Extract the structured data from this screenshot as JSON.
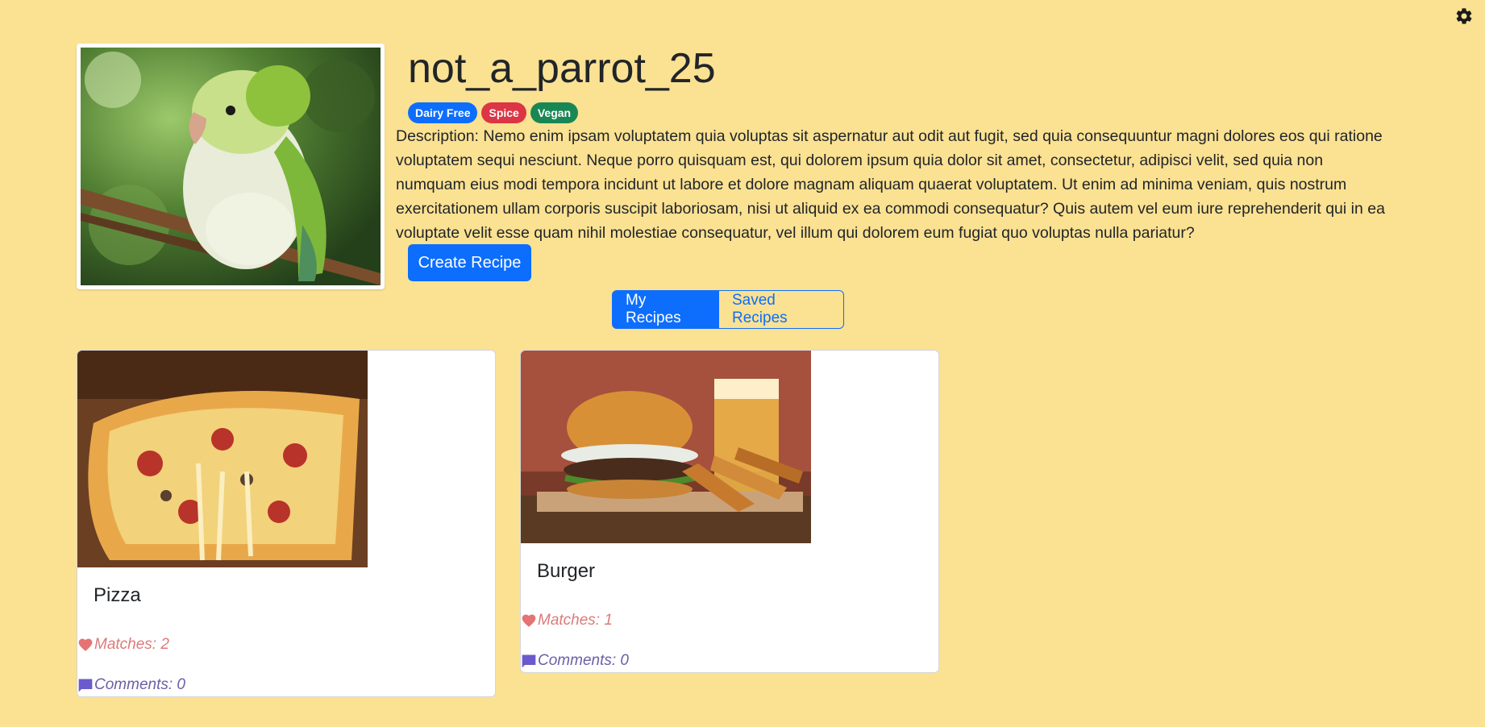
{
  "profile": {
    "username": "not_a_parrot_25",
    "photo": "parrot-photo",
    "badges": [
      {
        "label": "Dairy Free",
        "color": "#0d6efd"
      },
      {
        "label": "Spice",
        "color": "#dc3545"
      },
      {
        "label": "Vegan",
        "color": "#198754"
      }
    ],
    "description": "Description: Nemo enim ipsam voluptatem quia voluptas sit aspernatur aut odit aut fugit, sed quia consequuntur magni dolores eos qui ratione voluptatem sequi nesciunt. Neque porro quisquam est, qui dolorem ipsum quia dolor sit amet, consectetur, adipisci velit, sed quia non numquam eius modi tempora incidunt ut labore et dolore magnam aliquam quaerat voluptatem. Ut enim ad minima veniam, quis nostrum exercitationem ullam corporis suscipit laboriosam, nisi ut aliquid ex ea commodi consequatur? Quis autem vel eum iure reprehenderit qui in ea voluptate velit esse quam nihil molestiae consequatur, vel illum qui dolorem eum fugiat quo voluptas nulla pariatur?",
    "create_button": "Create Recipe"
  },
  "tabs": {
    "my_recipes": "My Recipes",
    "saved_recipes": "Saved Recipes",
    "active": "My Recipes"
  },
  "recipes": [
    {
      "title": "Pizza",
      "matches": "Matches: 2",
      "comments": "Comments: 0",
      "image": "pizza-photo"
    },
    {
      "title": "Burger",
      "matches": "Matches: 1",
      "comments": "Comments: 0",
      "image": "burger-photo"
    }
  ],
  "icons": {
    "settings": "gear-icon",
    "matches": "heart-icon",
    "comments": "comment-icon"
  },
  "colors": {
    "background": "#fbe192",
    "primary": "#0d6efd",
    "heart": "#e57373",
    "comment": "#6a5acd"
  }
}
